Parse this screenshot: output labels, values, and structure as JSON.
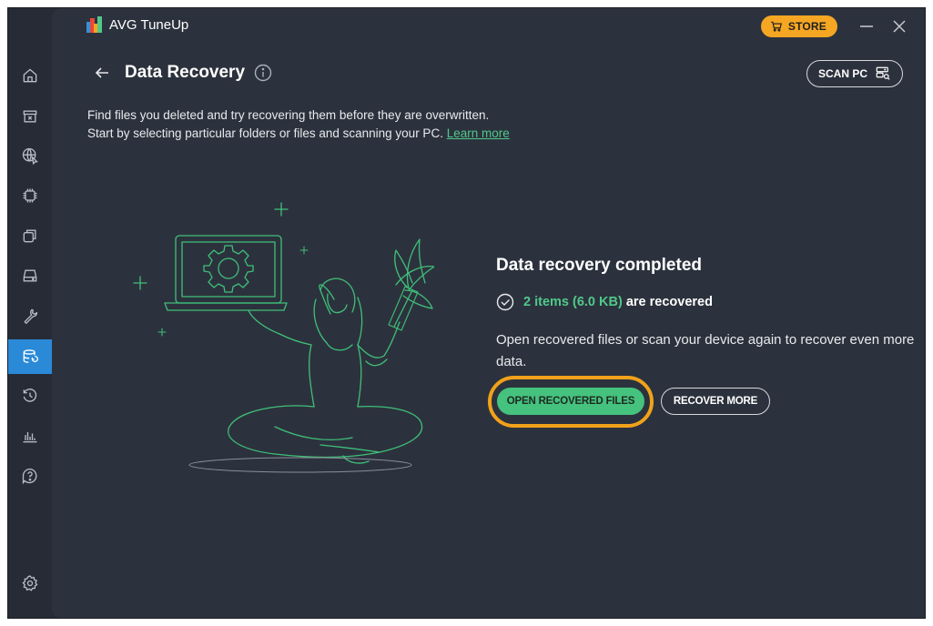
{
  "app": {
    "title": "AVG TuneUp",
    "store_label": "STORE"
  },
  "sidebar": {
    "items": [
      {
        "icon": "home-icon"
      },
      {
        "icon": "archive-icon"
      },
      {
        "icon": "globe-cursor-icon"
      },
      {
        "icon": "cpu-icon"
      },
      {
        "icon": "windows-stack-icon"
      },
      {
        "icon": "drive-icon"
      },
      {
        "icon": "wrench-icon"
      },
      {
        "icon": "data-recovery-icon",
        "active": true
      },
      {
        "icon": "history-icon"
      },
      {
        "icon": "bar-chart-icon"
      },
      {
        "icon": "help-icon"
      },
      {
        "icon": "gear-icon"
      }
    ],
    "active_color": "#2b8ad8"
  },
  "header": {
    "title": "Data Recovery",
    "scan_label": "SCAN PC"
  },
  "description": {
    "line1": "Find files you deleted and try recovering them before they are overwritten.",
    "line2": "Start by selecting particular folders or files and scanning your PC.",
    "learn_more": "Learn more"
  },
  "result": {
    "title": "Data recovery completed",
    "items": "2 items (6.0 KB)",
    "recovered_text": "are recovered",
    "description": "Open recovered files or scan your device again to recover even more data.",
    "open_button": "OPEN RECOVERED FILES",
    "recover_more_button": "RECOVER MORE"
  },
  "colors": {
    "accent_green": "#4fc98a",
    "button_green": "#45c27d",
    "highlight_orange": "#f1a21a",
    "store_orange": "#f5a623",
    "background": "#2c323d"
  }
}
